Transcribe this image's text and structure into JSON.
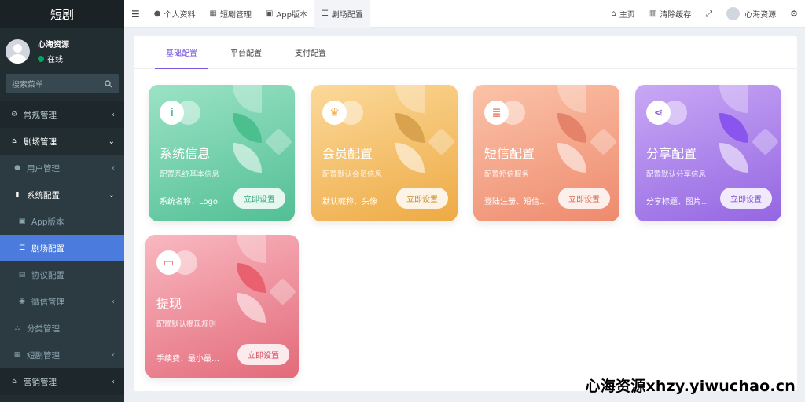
{
  "sidebar": {
    "brand": "短剧",
    "user_name": "心海资源",
    "user_status": "在线",
    "search_placeholder": "搜索菜单",
    "items": [
      {
        "label": "常规管理",
        "icon": "cogs-icon",
        "level": "top"
      },
      {
        "label": "剧场管理",
        "icon": "home-icon",
        "level": "open"
      },
      {
        "label": "用户管理",
        "icon": "user-icon",
        "level": "sub"
      },
      {
        "label": "系统配置",
        "icon": "file-icon",
        "level": "sub-open"
      },
      {
        "label": "App版本",
        "icon": "image-icon",
        "level": "sub2"
      },
      {
        "label": "剧场配置",
        "icon": "sliders-icon",
        "level": "active"
      },
      {
        "label": "协议配置",
        "icon": "file-text-icon",
        "level": "sub2"
      },
      {
        "label": "微信管理",
        "icon": "wechat-icon",
        "level": "sub2"
      },
      {
        "label": "分类管理",
        "icon": "sitemap-icon",
        "level": "sub"
      },
      {
        "label": "短剧管理",
        "icon": "film-icon",
        "level": "sub"
      },
      {
        "label": "营销管理",
        "icon": "home-icon",
        "level": "top"
      }
    ]
  },
  "topnav": {
    "menu_icon": "bars-icon",
    "tabs": [
      {
        "label": "个人资料",
        "icon": "user-icon"
      },
      {
        "label": "短剧管理",
        "icon": "film-icon"
      },
      {
        "label": "App版本",
        "icon": "image-icon"
      },
      {
        "label": "剧场配置",
        "icon": "sliders-icon"
      }
    ],
    "home": "主页",
    "clear_cache": "清除缓存",
    "user_name": "心海资源"
  },
  "content": {
    "tabs": [
      "基础配置",
      "平台配置",
      "支付配置"
    ],
    "cards": [
      {
        "title": "系统信息",
        "desc": "配置系统基本信息",
        "foot": "系统名称、Logo",
        "button": "立即设置",
        "icon": "info-icon",
        "color": "#4fc49a"
      },
      {
        "title": "会员配置",
        "desc": "配置默认会员信息",
        "foot": "默认昵称、头像",
        "button": "立即设置",
        "icon": "crown-icon",
        "color": "#f0b14a"
      },
      {
        "title": "短信配置",
        "desc": "配置短信服务",
        "foot": "登陆注册、短信…",
        "button": "立即设置",
        "icon": "database-icon",
        "color": "#f08a70"
      },
      {
        "title": "分享配置",
        "desc": "配置默认分享信息",
        "foot": "分享标题、图片…",
        "button": "立即设置",
        "icon": "share-icon",
        "color": "#9a6ee8"
      },
      {
        "title": "提现",
        "desc": "配置默认提现规则",
        "foot": "手续费、最小最…",
        "button": "立即设置",
        "icon": "wallet-icon",
        "color": "#ef7e8a"
      }
    ]
  },
  "watermark": "心海资源xhzy.yiwuchao.cn"
}
